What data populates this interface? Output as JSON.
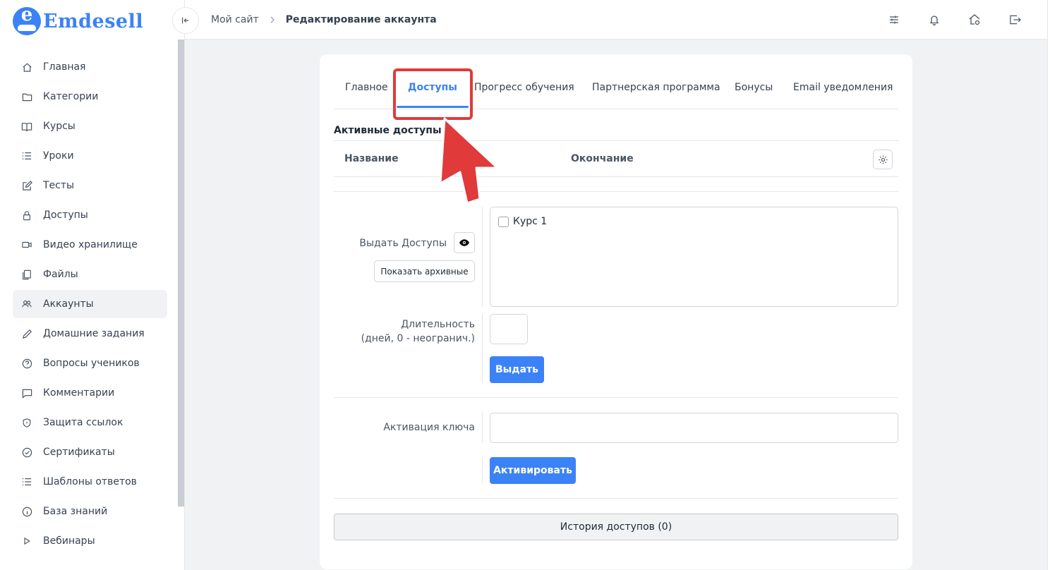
{
  "app": {
    "logo_text": "Emdesell",
    "logo_glyph": "e"
  },
  "colors": {
    "accent": "#3b82f6",
    "annotation": "#e03a3a"
  },
  "sidebar": {
    "items": [
      {
        "label": "Главная",
        "icon": "home-icon"
      },
      {
        "label": "Категории",
        "icon": "folder-icon"
      },
      {
        "label": "Курсы",
        "icon": "book-icon"
      },
      {
        "label": "Уроки",
        "icon": "list-icon"
      },
      {
        "label": "Тесты",
        "icon": "edit-icon"
      },
      {
        "label": "Доступы",
        "icon": "lock-icon"
      },
      {
        "label": "Видео хранилище",
        "icon": "video-icon"
      },
      {
        "label": "Файлы",
        "icon": "files-icon"
      },
      {
        "label": "Аккаунты",
        "icon": "users-icon",
        "active": true
      },
      {
        "label": "Домашние задания",
        "icon": "pencil-icon"
      },
      {
        "label": "Вопросы учеников",
        "icon": "question-icon"
      },
      {
        "label": "Комментарии",
        "icon": "comment-icon"
      },
      {
        "label": "Защита ссылок",
        "icon": "shield-icon"
      },
      {
        "label": "Сертификаты",
        "icon": "check-circle-icon"
      },
      {
        "label": "Шаблоны ответов",
        "icon": "list-icon"
      },
      {
        "label": "База знаний",
        "icon": "info-icon"
      },
      {
        "label": "Вебинары",
        "icon": "play-icon"
      }
    ]
  },
  "header": {
    "breadcrumb": {
      "parent": "Мой сайт",
      "current": "Редактирование аккаунта"
    },
    "icons": [
      "sliders-icon",
      "bell-icon",
      "home-settings-icon",
      "logout-icon"
    ]
  },
  "tabs": [
    {
      "label": "Главное"
    },
    {
      "label": "Доступы",
      "active": true
    },
    {
      "label": "Прогресс обучения"
    },
    {
      "label": "Партнерская программа"
    },
    {
      "label": "Бонусы"
    },
    {
      "label": "Email уведомления"
    }
  ],
  "active_access": {
    "title": "Активные доступы",
    "columns": {
      "name": "Название",
      "end": "Окончание"
    }
  },
  "grant": {
    "label": "Выдать Доступы",
    "show_archived": "Показать архивные",
    "courses": [
      {
        "label": "Курс 1",
        "checked": false
      }
    ],
    "duration_label_1": "Длительность",
    "duration_label_2": "(дней, 0 - неогранич.)",
    "duration_value": "",
    "submit": "Выдать"
  },
  "key": {
    "label": "Активация ключа",
    "value": "",
    "submit": "Активировать"
  },
  "history_button": "История доступов (0)"
}
